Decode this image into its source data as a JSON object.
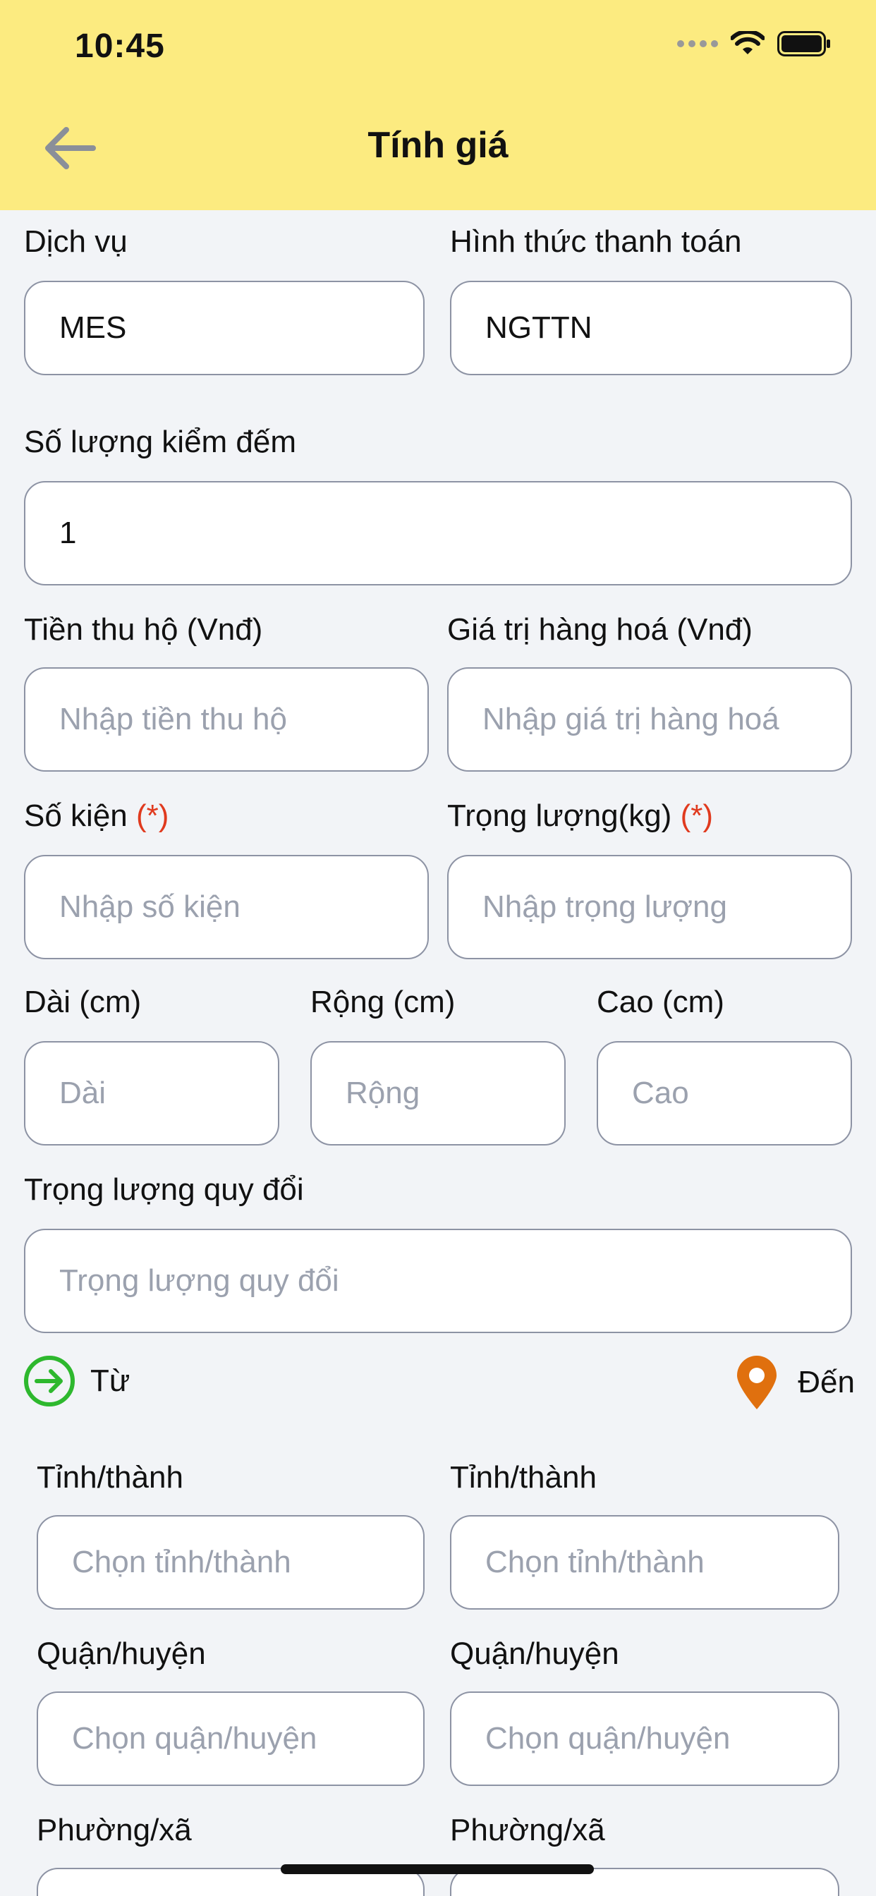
{
  "status_bar": {
    "time": "10:45"
  },
  "header": {
    "title": "Tính giá"
  },
  "form": {
    "service": {
      "label": "Dịch vụ",
      "value": "MES"
    },
    "payment": {
      "label": "Hình thức thanh toán",
      "value": "NGTTN"
    },
    "count_check": {
      "label": "Số lượng kiểm đếm",
      "value": "1"
    },
    "cod": {
      "label": "Tiền thu hộ (Vnđ)",
      "placeholder": "Nhập tiền thu hộ"
    },
    "goods_value": {
      "label": "Giá trị hàng hoá (Vnđ)",
      "placeholder": "Nhập giá trị hàng hoá"
    },
    "packages": {
      "label": "Số kiện",
      "required": "(*)",
      "placeholder": "Nhập số kiện"
    },
    "weight": {
      "label": "Trọng lượng(kg)",
      "required": "(*)",
      "placeholder": "Nhập trọng lượng"
    },
    "length": {
      "label": "Dài (cm)",
      "placeholder": "Dài"
    },
    "width": {
      "label": "Rộng (cm)",
      "placeholder": "Rộng"
    },
    "height": {
      "label": "Cao (cm)",
      "placeholder": "Cao"
    },
    "converted_weight": {
      "label": "Trọng lượng quy đổi",
      "placeholder": "Trọng lượng quy đổi"
    }
  },
  "route": {
    "from_label": "Từ",
    "to_label": "Đến",
    "from_icon": "arrow-right-circle-icon",
    "to_icon": "location-pin-icon",
    "province_label": "Tỉnh/thành",
    "province_placeholder": "Chọn tỉnh/thành",
    "district_label": "Quận/huyện",
    "district_placeholder": "Chọn quận/huyện",
    "ward_label": "Phường/xã"
  },
  "colors": {
    "header_bg": "#FCEB80",
    "required": "#E03A1E",
    "from_icon": "#2EB82E",
    "to_icon": "#E0700E"
  }
}
